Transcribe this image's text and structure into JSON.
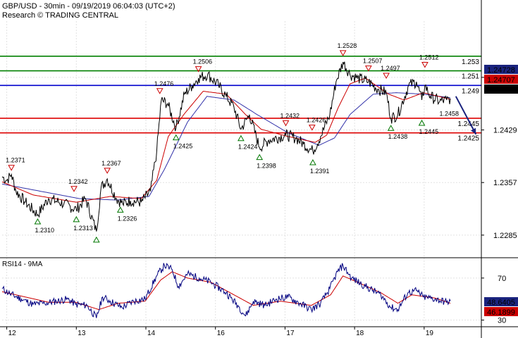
{
  "header": {
    "line1": "GBP/USD - 30min - 09/19/2019 06:04:03 (UTC+2)",
    "line2": "Research © TRADING CENTRAL"
  },
  "chart_data": {
    "type": "line",
    "main": {
      "series": [
        {
          "role": "price",
          "color": "#000000"
        },
        {
          "role": "ma-fast",
          "color": "#cc0000"
        },
        {
          "role": "ma-slow",
          "color": "#3333aa"
        }
      ],
      "ylim": [
        1.2255,
        1.2578
      ],
      "y_ticks": [
        1.2501,
        1.2429,
        1.2357,
        1.2285
      ],
      "y_tick_labels": [
        "1.2501",
        "1.2429",
        "1.2357",
        "1.2285"
      ],
      "x_ticks": [
        {
          "t": 6,
          "label": "12"
        },
        {
          "t": 96,
          "label": "13"
        },
        {
          "t": 186,
          "label": "14"
        },
        {
          "t": 276,
          "label": "16"
        },
        {
          "t": 366,
          "label": "17"
        },
        {
          "t": 456,
          "label": "18"
        },
        {
          "t": 546,
          "label": "19"
        }
      ],
      "levels": [
        {
          "value": 1.253,
          "label": "1.253",
          "color": "#008000"
        },
        {
          "value": 1.251,
          "label": "1.251",
          "color": "#008000"
        },
        {
          "value": 1.249,
          "label": "1.249",
          "color": "#0000cc"
        },
        {
          "value": 1.2445,
          "label": "1.2445",
          "color": "#dd0000"
        },
        {
          "value": 1.2425,
          "label": "1.2425",
          "color": "#dd0000"
        }
      ],
      "price_boxes": [
        {
          "value": 1.24728,
          "label": "1.24728",
          "bg": "#1a237e"
        },
        {
          "value": 1.24707,
          "label": "1.24707",
          "bg": "#cc0000"
        },
        {
          "value": 1.247,
          "label": "1.247",
          "bg": "#000000"
        }
      ],
      "annotations": [
        {
          "t": 12,
          "v": 1.2371,
          "label": "1.2371",
          "kind": "high"
        },
        {
          "t": 46,
          "v": 1.231,
          "label": "1.2310",
          "kind": "low"
        },
        {
          "t": 93,
          "v": 1.2342,
          "label": "1.2342",
          "kind": "high"
        },
        {
          "t": 96,
          "v": 1.2313,
          "label": "1.2313",
          "kind": "low"
        },
        {
          "t": 122,
          "v": 1.2285,
          "label": "",
          "kind": "low"
        },
        {
          "t": 136,
          "v": 1.2367,
          "label": "1.2367",
          "kind": "high"
        },
        {
          "t": 153,
          "v": 1.2326,
          "label": "1.2326",
          "kind": "low"
        },
        {
          "t": 204,
          "v": 1.2476,
          "label": "1.2476",
          "kind": "high"
        },
        {
          "t": 225,
          "v": 1.2425,
          "label": "1.2425",
          "kind": "low"
        },
        {
          "t": 254,
          "v": 1.2506,
          "label": "1.2506",
          "kind": "high"
        },
        {
          "t": 309,
          "v": 1.2424,
          "label": "1.2424",
          "kind": "low"
        },
        {
          "t": 333,
          "v": 1.2398,
          "label": "1.2398",
          "kind": "low"
        },
        {
          "t": 367,
          "v": 1.2432,
          "label": "1.2432",
          "kind": "high"
        },
        {
          "t": 401,
          "v": 1.2426,
          "label": "1.2426",
          "kind": "high"
        },
        {
          "t": 402,
          "v": 1.2391,
          "label": "1.2391",
          "kind": "low"
        },
        {
          "t": 441,
          "v": 1.2528,
          "label": "1.2528",
          "kind": "high"
        },
        {
          "t": 474,
          "v": 1.2507,
          "label": "1.2507",
          "kind": "high"
        },
        {
          "t": 497,
          "v": 1.2497,
          "label": "1.2497",
          "kind": "high"
        },
        {
          "t": 503,
          "v": 1.2438,
          "label": "1.2438",
          "kind": "low"
        },
        {
          "t": 547,
          "v": 1.2512,
          "label": "1.2512",
          "kind": "high"
        },
        {
          "t": 543,
          "v": 1.2445,
          "label": "1.2445",
          "kind": "low"
        },
        {
          "t": 573,
          "v": 1.2458,
          "label": "1.2458",
          "kind": "label"
        }
      ],
      "forecast_arrow": {
        "from": {
          "t": 587,
          "v": 1.2475
        },
        "to": {
          "t": 613,
          "v": 1.2423
        }
      }
    },
    "rsi": {
      "title": "RSI14 - 9MA",
      "ylim": [
        25,
        88
      ],
      "y_ticks": [
        70,
        30
      ],
      "y_tick_labels": [
        "70",
        "30"
      ],
      "boxes": [
        {
          "value": 48.6405,
          "label": "48.6405",
          "bg": "#1a237e"
        },
        {
          "value": 46.1899,
          "label": "46.1899",
          "bg": "#cc0000"
        }
      ]
    },
    "anchors": {
      "price": [
        [
          0,
          1.2365
        ],
        [
          6,
          1.236
        ],
        [
          12,
          1.2368
        ],
        [
          18,
          1.2345
        ],
        [
          30,
          1.233
        ],
        [
          46,
          1.2313
        ],
        [
          60,
          1.2335
        ],
        [
          80,
          1.2328
        ],
        [
          96,
          1.232
        ],
        [
          108,
          1.2335
        ],
        [
          122,
          1.229
        ],
        [
          128,
          1.235
        ],
        [
          136,
          1.2362
        ],
        [
          148,
          1.2335
        ],
        [
          156,
          1.2328
        ],
        [
          166,
          1.2332
        ],
        [
          180,
          1.233
        ],
        [
          192,
          1.2345
        ],
        [
          200,
          1.24
        ],
        [
          206,
          1.247
        ],
        [
          214,
          1.2465
        ],
        [
          225,
          1.2432
        ],
        [
          236,
          1.2478
        ],
        [
          246,
          1.249
        ],
        [
          254,
          1.25
        ],
        [
          266,
          1.2505
        ],
        [
          280,
          1.249
        ],
        [
          290,
          1.2475
        ],
        [
          300,
          1.246
        ],
        [
          309,
          1.243
        ],
        [
          320,
          1.245
        ],
        [
          333,
          1.2405
        ],
        [
          345,
          1.2415
        ],
        [
          367,
          1.2422
        ],
        [
          380,
          1.2418
        ],
        [
          390,
          1.241
        ],
        [
          402,
          1.24
        ],
        [
          412,
          1.242
        ],
        [
          424,
          1.245
        ],
        [
          432,
          1.2495
        ],
        [
          441,
          1.2522
        ],
        [
          450,
          1.2505
        ],
        [
          460,
          1.25
        ],
        [
          474,
          1.2495
        ],
        [
          486,
          1.2485
        ],
        [
          497,
          1.248
        ],
        [
          503,
          1.2445
        ],
        [
          512,
          1.245
        ],
        [
          526,
          1.249
        ],
        [
          536,
          1.2495
        ],
        [
          543,
          1.247
        ],
        [
          547,
          1.249
        ],
        [
          554,
          1.2475
        ],
        [
          566,
          1.2468
        ],
        [
          575,
          1.247
        ],
        [
          580,
          1.2472
        ]
      ],
      "ma_fast": [
        [
          0,
          1.2358
        ],
        [
          40,
          1.234
        ],
        [
          96,
          1.233
        ],
        [
          140,
          1.2338
        ],
        [
          180,
          1.2335
        ],
        [
          200,
          1.236
        ],
        [
          215,
          1.242
        ],
        [
          235,
          1.245
        ],
        [
          260,
          1.2482
        ],
        [
          290,
          1.2478
        ],
        [
          315,
          1.245
        ],
        [
          335,
          1.243
        ],
        [
          370,
          1.242
        ],
        [
          405,
          1.2412
        ],
        [
          420,
          1.2422
        ],
        [
          435,
          1.246
        ],
        [
          450,
          1.2492
        ],
        [
          470,
          1.25
        ],
        [
          500,
          1.2478
        ],
        [
          520,
          1.247
        ],
        [
          545,
          1.248
        ],
        [
          580,
          1.2471
        ]
      ],
      "ma_slow": [
        [
          0,
          1.2355
        ],
        [
          50,
          1.2345
        ],
        [
          100,
          1.2335
        ],
        [
          150,
          1.2333
        ],
        [
          190,
          1.2338
        ],
        [
          210,
          1.2375
        ],
        [
          240,
          1.244
        ],
        [
          265,
          1.2475
        ],
        [
          300,
          1.247
        ],
        [
          330,
          1.245
        ],
        [
          370,
          1.2425
        ],
        [
          410,
          1.2408
        ],
        [
          430,
          1.2418
        ],
        [
          450,
          1.245
        ],
        [
          480,
          1.2478
        ],
        [
          510,
          1.248
        ],
        [
          545,
          1.2478
        ],
        [
          580,
          1.2473
        ]
      ],
      "rsi": [
        [
          0,
          60
        ],
        [
          10,
          55
        ],
        [
          25,
          50
        ],
        [
          40,
          45
        ],
        [
          55,
          46
        ],
        [
          70,
          48
        ],
        [
          85,
          50
        ],
        [
          95,
          45
        ],
        [
          110,
          44
        ],
        [
          122,
          32
        ],
        [
          130,
          52
        ],
        [
          140,
          48
        ],
        [
          155,
          42
        ],
        [
          170,
          48
        ],
        [
          185,
          50
        ],
        [
          200,
          72
        ],
        [
          210,
          82
        ],
        [
          220,
          78
        ],
        [
          228,
          62
        ],
        [
          240,
          74
        ],
        [
          255,
          70
        ],
        [
          270,
          66
        ],
        [
          290,
          56
        ],
        [
          305,
          44
        ],
        [
          315,
          34
        ],
        [
          325,
          48
        ],
        [
          340,
          44
        ],
        [
          355,
          50
        ],
        [
          370,
          52
        ],
        [
          385,
          46
        ],
        [
          400,
          40
        ],
        [
          412,
          46
        ],
        [
          424,
          60
        ],
        [
          434,
          76
        ],
        [
          441,
          82
        ],
        [
          452,
          70
        ],
        [
          470,
          62
        ],
        [
          490,
          54
        ],
        [
          503,
          42
        ],
        [
          512,
          40
        ],
        [
          525,
          56
        ],
        [
          536,
          58
        ],
        [
          545,
          52
        ],
        [
          560,
          50
        ],
        [
          575,
          47
        ],
        [
          580,
          48
        ]
      ],
      "rsi_ma": [
        [
          0,
          57
        ],
        [
          30,
          52
        ],
        [
          60,
          47
        ],
        [
          95,
          47
        ],
        [
          125,
          40
        ],
        [
          150,
          46
        ],
        [
          185,
          48
        ],
        [
          205,
          68
        ],
        [
          220,
          76
        ],
        [
          240,
          70
        ],
        [
          270,
          66
        ],
        [
          300,
          54
        ],
        [
          325,
          44
        ],
        [
          360,
          48
        ],
        [
          400,
          44
        ],
        [
          425,
          54
        ],
        [
          441,
          72
        ],
        [
          460,
          66
        ],
        [
          490,
          56
        ],
        [
          512,
          46
        ],
        [
          530,
          54
        ],
        [
          560,
          51
        ],
        [
          580,
          46
        ]
      ]
    }
  }
}
